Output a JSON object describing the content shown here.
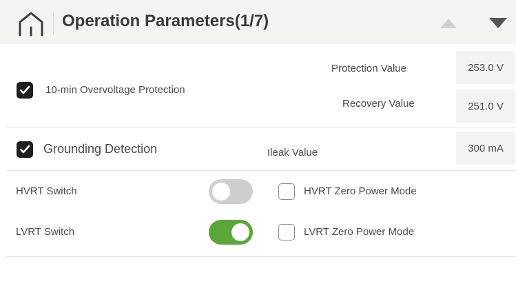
{
  "header": {
    "title": "Operation Parameters(1/7)",
    "home_icon": "home-icon",
    "up_icon": "triangle-up-icon",
    "down_icon": "triangle-down-icon"
  },
  "overvoltage": {
    "label": "10-min Overvoltage Protection",
    "checked": true,
    "protection_label": "Protection Value",
    "protection_value": "253.0 V",
    "recovery_label": "Recovery Value",
    "recovery_value": "251.0 V"
  },
  "grounding": {
    "label": "Grounding Detection",
    "checked": true,
    "ileak_label": "Ileak Value",
    "ileak_value": "300 mA"
  },
  "hvrt": {
    "switch_label": "HVRT Switch",
    "switch_on": false,
    "zero_power_label": "HVRT Zero Power Mode",
    "zero_power_checked": false
  },
  "lvrt": {
    "switch_label": "LVRT Switch",
    "switch_on": true,
    "zero_power_label": "LVRT Zero Power Mode",
    "zero_power_checked": false
  },
  "colors": {
    "header_bg": "#f4f4f1",
    "toggle_on": "#5aa639",
    "toggle_off": "#cfcfcf",
    "checkbox_on": "#1f1f1f"
  }
}
